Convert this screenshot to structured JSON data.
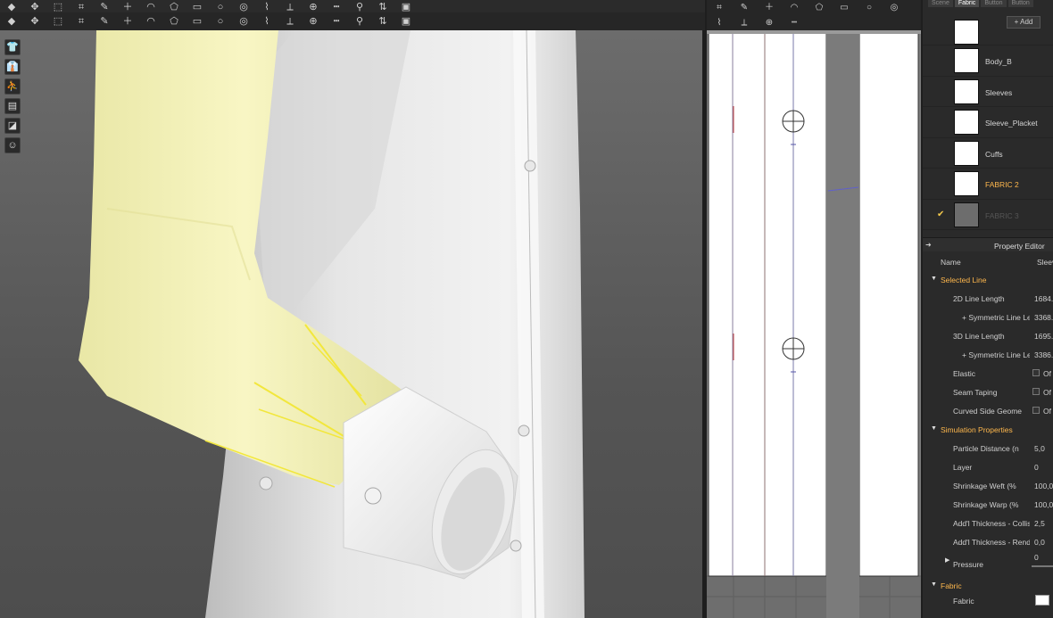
{
  "top_toolbar": {
    "row1_icons": [
      "menu-arrow-icon",
      "move-tool-icon",
      "transform-icon",
      "segment-icon",
      "edit-curve-icon",
      "add-point-icon",
      "curve-point-icon",
      "polygon-icon",
      "rectangle-icon",
      "circle-icon",
      "internal-shape-icon",
      "trace-icon",
      "seam-icon",
      "tack-icon",
      "topstitch-icon",
      "pin-icon",
      "fold-arrange-icon",
      "arrangement-icon"
    ],
    "row2_icons": [
      "simulation-icon",
      "avatar-select-icon",
      "avatar-move-icon",
      "point-icon",
      "measure-icon",
      "button-icon",
      "buttonhole-icon",
      "zipper-icon",
      "puckering-icon",
      "tape-icon",
      "elastic-icon",
      "symmetric-icon",
      "fold-icon",
      "split-icon",
      "merge-icon",
      "stitch-icon",
      "hide-icon",
      "reset-icon"
    ],
    "pattern_window_icons": [
      "select-icon",
      "transform-pattern-icon",
      "edit-point-icon",
      "add-point-icon",
      "curve-icon",
      "notch-icon",
      "segment-sew-icon",
      "free-sew-icon",
      "seam-tape-icon",
      "fold-icon",
      "trace-icon",
      "print-icon"
    ]
  },
  "left_tools": [
    "avatar-shirt-icon",
    "avatar-garment-icon",
    "avatar-body-icon",
    "texture-view-icon",
    "fabric-view-icon",
    "avatar-skin-icon"
  ],
  "right_panel": {
    "tabs": [
      "Scene",
      "Fabric",
      "Button",
      "Button"
    ],
    "add_button": "+ Add",
    "fabric_list": [
      {
        "name": "Body_B",
        "selected": false,
        "dim": false
      },
      {
        "name": "Sleeves",
        "selected": false,
        "dim": false
      },
      {
        "name": "Sleeve_Placket",
        "selected": false,
        "dim": false
      },
      {
        "name": "Cuffs",
        "selected": false,
        "dim": false
      },
      {
        "name": "FABRIC 2",
        "selected": true,
        "dim": false
      },
      {
        "name": "FABRIC 3",
        "selected": false,
        "dim": true
      }
    ],
    "property_editor_title": "Property Editor",
    "name_label": "Name",
    "name_value": "Sleev",
    "selected_line": {
      "title": "Selected Line",
      "rows": [
        {
          "label": "2D Line Length",
          "value": "1684.",
          "indent": false
        },
        {
          "label": "+ Symmetric Line Le",
          "value": "3368.",
          "indent": true
        },
        {
          "label": "3D Line Length",
          "value": "1695.",
          "indent": false
        },
        {
          "label": "+ Symmetric Line Le",
          "value": "3386.",
          "indent": true
        },
        {
          "label": "Elastic",
          "value": "Of",
          "checkbox": true
        },
        {
          "label": "Seam Taping",
          "value": "Of",
          "checkbox": true
        },
        {
          "label": "Curved Side Geome",
          "value": "Of",
          "checkbox": true
        }
      ]
    },
    "simulation": {
      "title": "Simulation Properties",
      "rows": [
        {
          "label": "Particle Distance (n",
          "value": "5,0"
        },
        {
          "label": "Layer",
          "value": "0"
        },
        {
          "label": "Shrinkage Weft (%",
          "value": "100,0"
        },
        {
          "label": "Shrinkage Warp (%",
          "value": "100,0"
        },
        {
          "label": "Add'l Thickness - Collisic",
          "value": "2,5"
        },
        {
          "label": "Add'l Thickness - Render",
          "value": "0,0"
        }
      ],
      "pressure_label": "Pressure",
      "pressure_value": "0"
    },
    "fabric_section": {
      "title": "Fabric",
      "row_label": "Fabric"
    }
  }
}
